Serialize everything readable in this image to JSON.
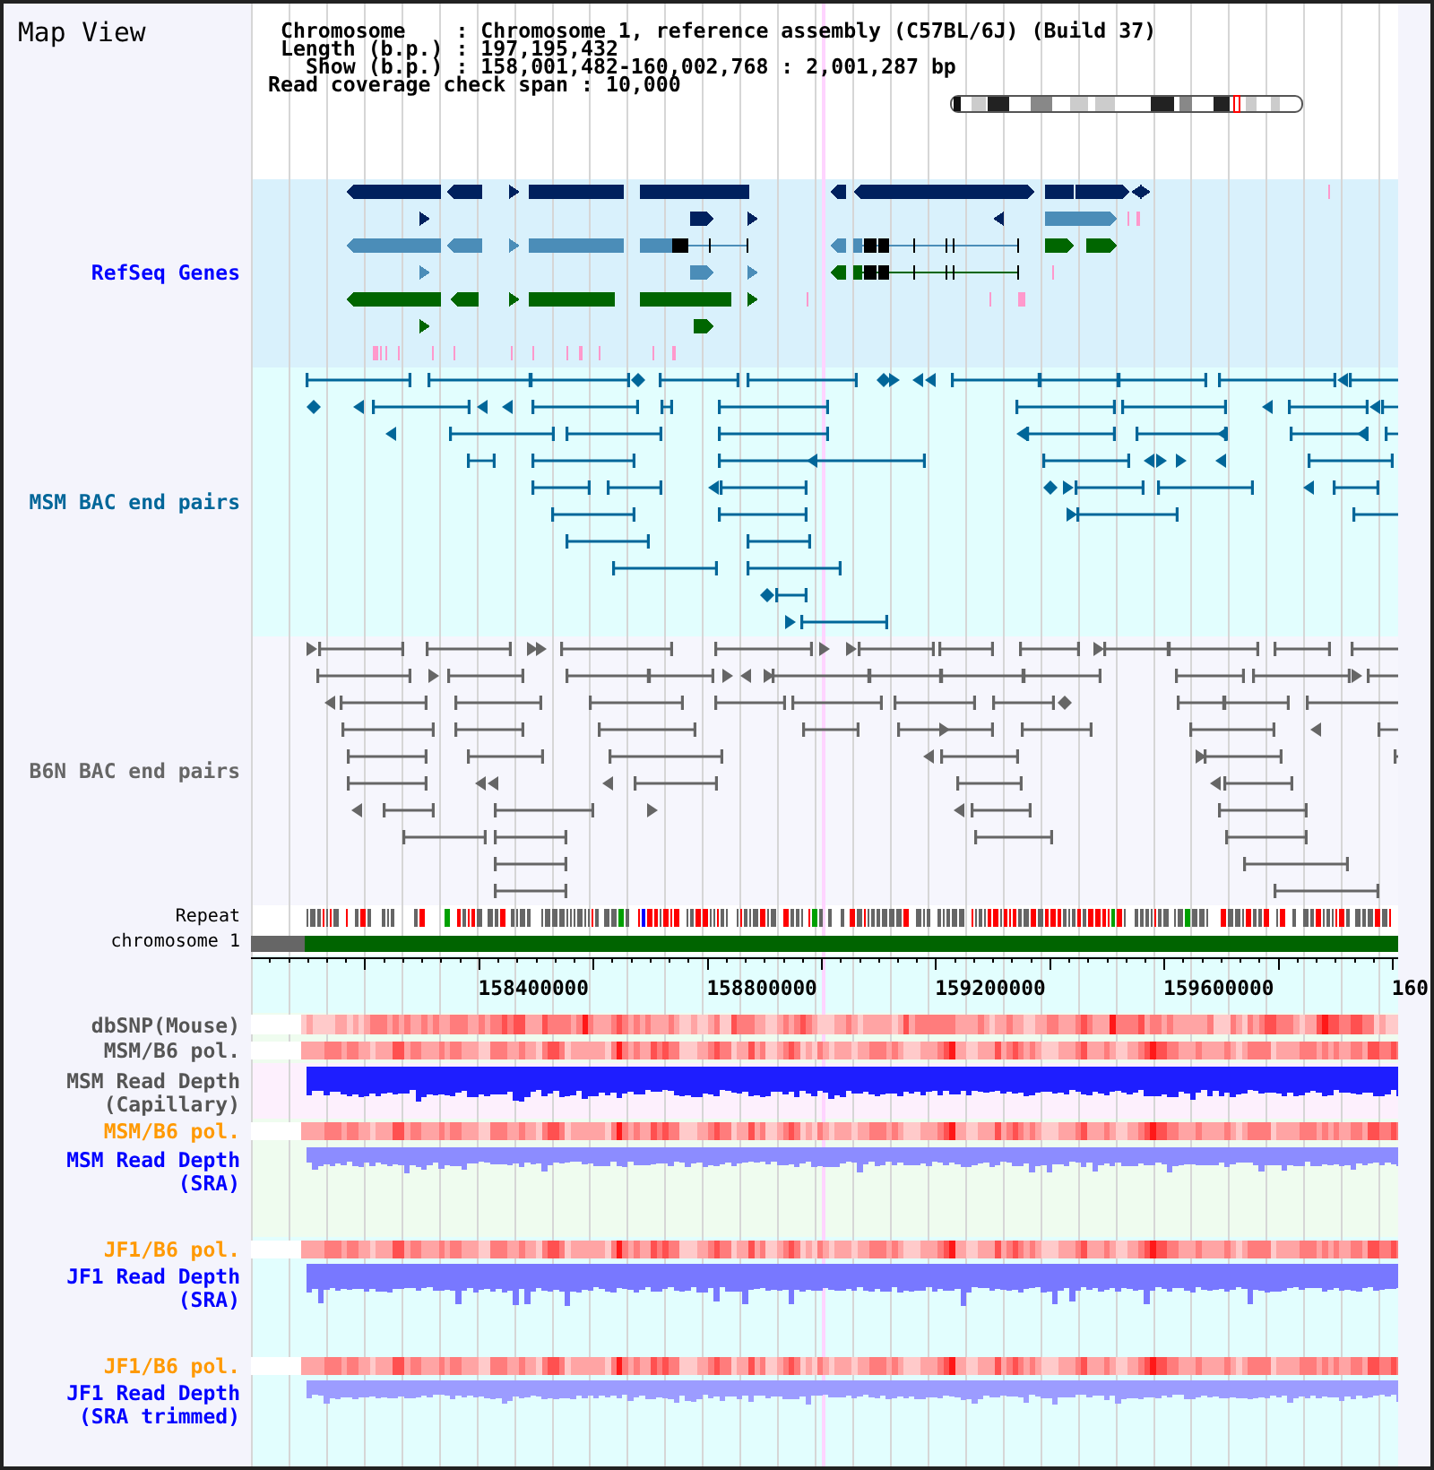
{
  "title": "Map View",
  "info": [
    "Chromosome    : Chromosome 1, reference assembly (C57BL/6J) (Build 37)",
    "Length (b.p.) : 197,195,432",
    "Show (b.p.) : 158,001,482-160,002,768 : 2,001,287 bp",
    "Read coverage check span : 10,000"
  ],
  "tracks": [
    {
      "kind": "genes",
      "label": "RefSeq Genes",
      "color": "#0000ff"
    },
    {
      "kind": "pairs",
      "label": "MSM BAC end pairs",
      "color": "#006699"
    },
    {
      "kind": "pairs",
      "label": "B6N BAC end pairs",
      "color": "#666666"
    },
    {
      "kind": "repeat",
      "label": "Repeat",
      "color": "#000000"
    },
    {
      "kind": "chromosome",
      "label": "chromosome 1",
      "color": "#000000"
    },
    {
      "kind": "axis",
      "ticks": [
        "158400000",
        "158800000",
        "159200000",
        "159600000",
        "160"
      ]
    },
    {
      "kind": "heatmap",
      "label": "dbSNP(Mouse)",
      "color": "#555555"
    },
    {
      "kind": "heatmap",
      "label": "MSM/B6 pol.",
      "color": "#555555"
    },
    {
      "kind": "depth",
      "label": "MSM Read Depth (Capillary)",
      "color": "#555555"
    },
    {
      "kind": "heatmap",
      "label": "MSM/B6 pol.",
      "color": "#ff9900"
    },
    {
      "kind": "depth",
      "label": "MSM Read Depth (SRA)",
      "color": "#0000ff"
    },
    {
      "kind": "heatmap",
      "label": "JF1/B6 pol.",
      "color": "#ff9900"
    },
    {
      "kind": "depth",
      "label": "JF1 Read Depth (SRA)",
      "color": "#0000ff"
    },
    {
      "kind": "heatmap",
      "label": "JF1/B6 pol.",
      "color": "#ff9900"
    },
    {
      "kind": "depth",
      "label": "JF1 Read Depth (SRA trimmed)",
      "color": "#0000ff"
    }
  ]
}
